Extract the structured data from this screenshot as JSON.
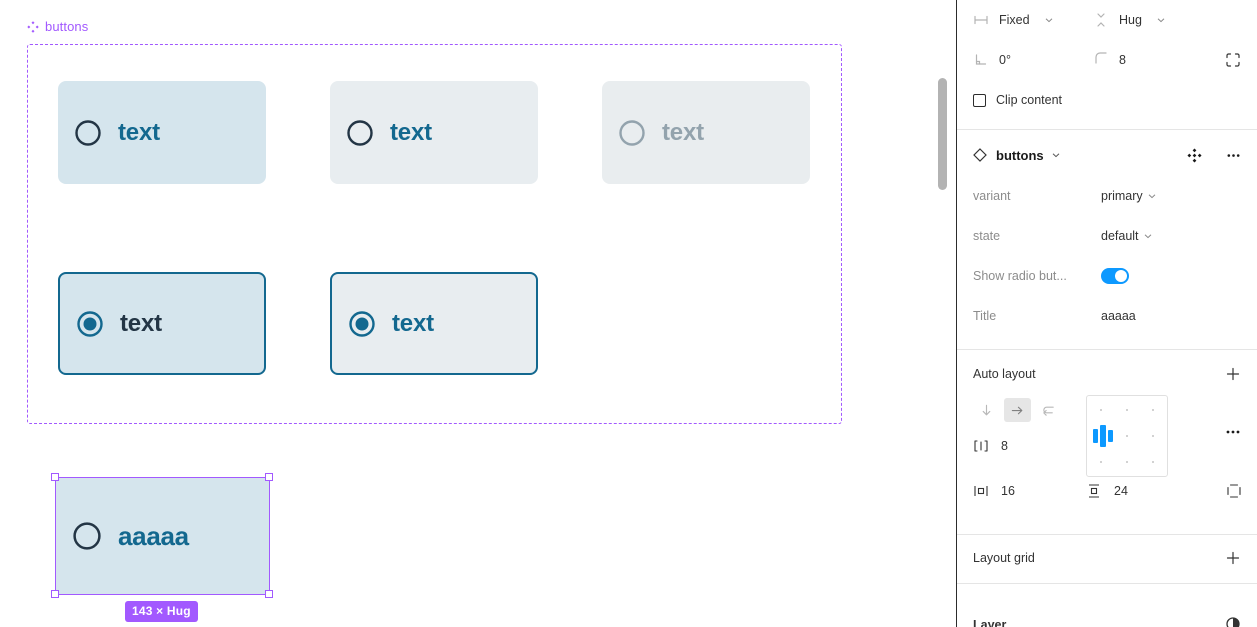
{
  "canvas": {
    "component_label": "buttons",
    "component_icon": "component-diamond-icon",
    "buttons_row1": [
      {
        "text": "text",
        "variant": "primary",
        "radio": "radio-empty-dark",
        "state": "default"
      },
      {
        "text": "text",
        "variant": "secondary",
        "radio": "radio-empty-dark",
        "state": "default"
      },
      {
        "text": "text",
        "variant": "disabled",
        "radio": "radio-empty-gray",
        "state": "disabled"
      }
    ],
    "buttons_row2": [
      {
        "text": "text",
        "variant": "selected-primary",
        "radio": "radio-filled-teal",
        "state": "selected"
      },
      {
        "text": "text",
        "variant": "selected-secondary",
        "radio": "radio-filled-teal",
        "state": "selected"
      }
    ],
    "selected_instance": {
      "text": "aaaaa",
      "radio": "radio-empty-dark",
      "size_badge": "143 × Hug"
    }
  },
  "right_panel": {
    "frame": {
      "width_mode_icon": "horizontal-resize-icon",
      "width_mode": "Fixed",
      "height_mode_icon": "vertical-resize-icon",
      "height_mode": "Hug",
      "rotation_icon": "angle-icon",
      "rotation": "0°",
      "corner_radius_icon": "corner-radius-icon",
      "corner_radius": "8",
      "independent_corners_icon": "independent-corners-icon",
      "clip_content_label": "Clip content",
      "clip_content_checked": false
    },
    "component": {
      "icon": "component-diamond-icon",
      "name": "buttons",
      "swap_icon": "swap-instance-icon",
      "more_icon": "more-options-icon",
      "properties": [
        {
          "label": "variant",
          "value": "primary",
          "type": "select"
        },
        {
          "label": "state",
          "value": "default",
          "type": "select"
        },
        {
          "label": "Show radio but...",
          "value": "on",
          "type": "toggle"
        },
        {
          "label": "Title",
          "value": "aaaaa",
          "type": "text"
        }
      ]
    },
    "auto_layout": {
      "title": "Auto layout",
      "add_icon": "plus-icon",
      "direction_vertical_icon": "arrow-down-icon",
      "direction_horizontal_icon": "arrow-right-icon",
      "direction_wrap_icon": "wrap-icon",
      "direction_active": "horizontal",
      "gap_icon": "gap-spacing-icon",
      "gap": "8",
      "alignment": "left-center",
      "more_icon": "more-options-icon",
      "horizontal_padding_icon": "horizontal-padding-icon",
      "horizontal_padding": "16",
      "vertical_padding_icon": "vertical-padding-icon",
      "vertical_padding": "24",
      "individual_padding_icon": "individual-padding-icon"
    },
    "layout_grid": {
      "title": "Layout grid",
      "add_icon": "plus-icon"
    },
    "layer_section": {
      "title": "Layer",
      "icon": "blend-mode-icon"
    }
  },
  "colors": {
    "accent_purple": "#a259ff",
    "accent_blue": "#0d99ff",
    "teal": "#13688f",
    "primary_fill": "#d5e5ed",
    "secondary_fill": "#e8edf0",
    "disabled_fill": "#e9edef",
    "disabled_text": "#93a3ad",
    "dark_text": "#233545"
  }
}
